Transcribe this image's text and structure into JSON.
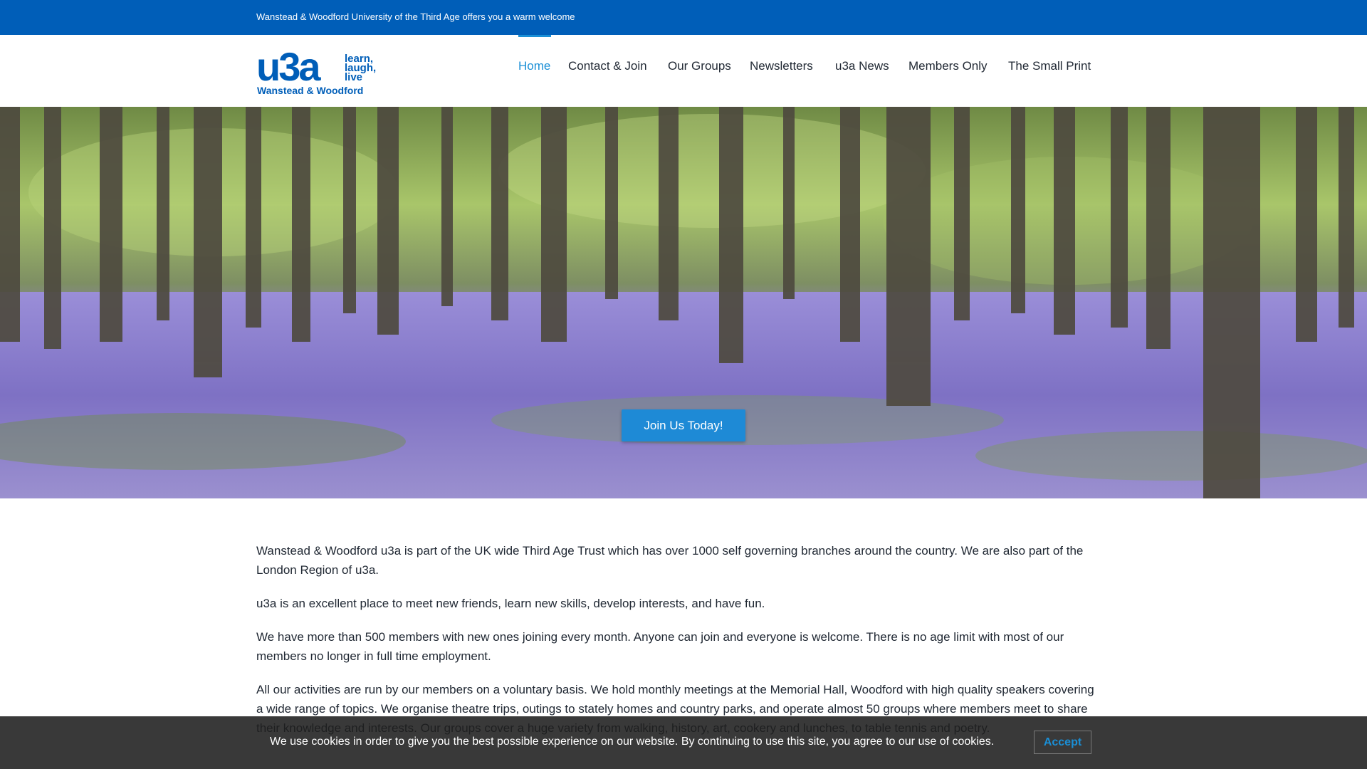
{
  "topbar": {
    "welcome": "Wanstead & Woodford University of the Third Age offers you a warm welcome"
  },
  "logo": {
    "mark": "u3a",
    "tagline": [
      "learn,",
      "laugh,",
      "live"
    ],
    "branch": "Wanstead & Woodford",
    "color": "#005eb8"
  },
  "nav": {
    "items": [
      {
        "label": "Home",
        "active": true
      },
      {
        "label": "Contact & Join",
        "active": false
      },
      {
        "label": "Our Groups",
        "active": false
      },
      {
        "label": "Newsletters",
        "active": false
      },
      {
        "label": "u3a News",
        "active": false
      },
      {
        "label": "Members Only",
        "active": false
      },
      {
        "label": "The Small Print",
        "active": false
      }
    ],
    "accent": "#1a8fd6"
  },
  "hero": {
    "button_label": "Join Us Today!"
  },
  "content": {
    "paragraphs": [
      "Wanstead & Woodford u3a is part of the UK wide Third Age Trust which has over 1000 self governing branches around the country. We are also part of the London Region of u3a.",
      "u3a is an excellent place to meet new friends, learn new skills, develop interests, and have fun.",
      "We have more than 500 members with new ones joining every month. Anyone can join and everyone is welcome. There is no age limit with most of our members no longer in full time employment.",
      "All our activities are run by our members on a voluntary basis. We hold monthly meetings at the Memorial Hall, Woodford with high quality speakers covering a wide range of topics. We organise theatre trips, outings to stately homes and country parks, and operate almost 50 groups where members meet to share their knowledge and interests. Our groups cover a huge variety from walking, history, art, cookery and lunches, to table tennis and poetry."
    ]
  },
  "cookie": {
    "message": "We use cookies in order to give you the best possible experience on our website. By continuing to use this site, you agree to our use of cookies.",
    "accept_label": "Accept"
  }
}
